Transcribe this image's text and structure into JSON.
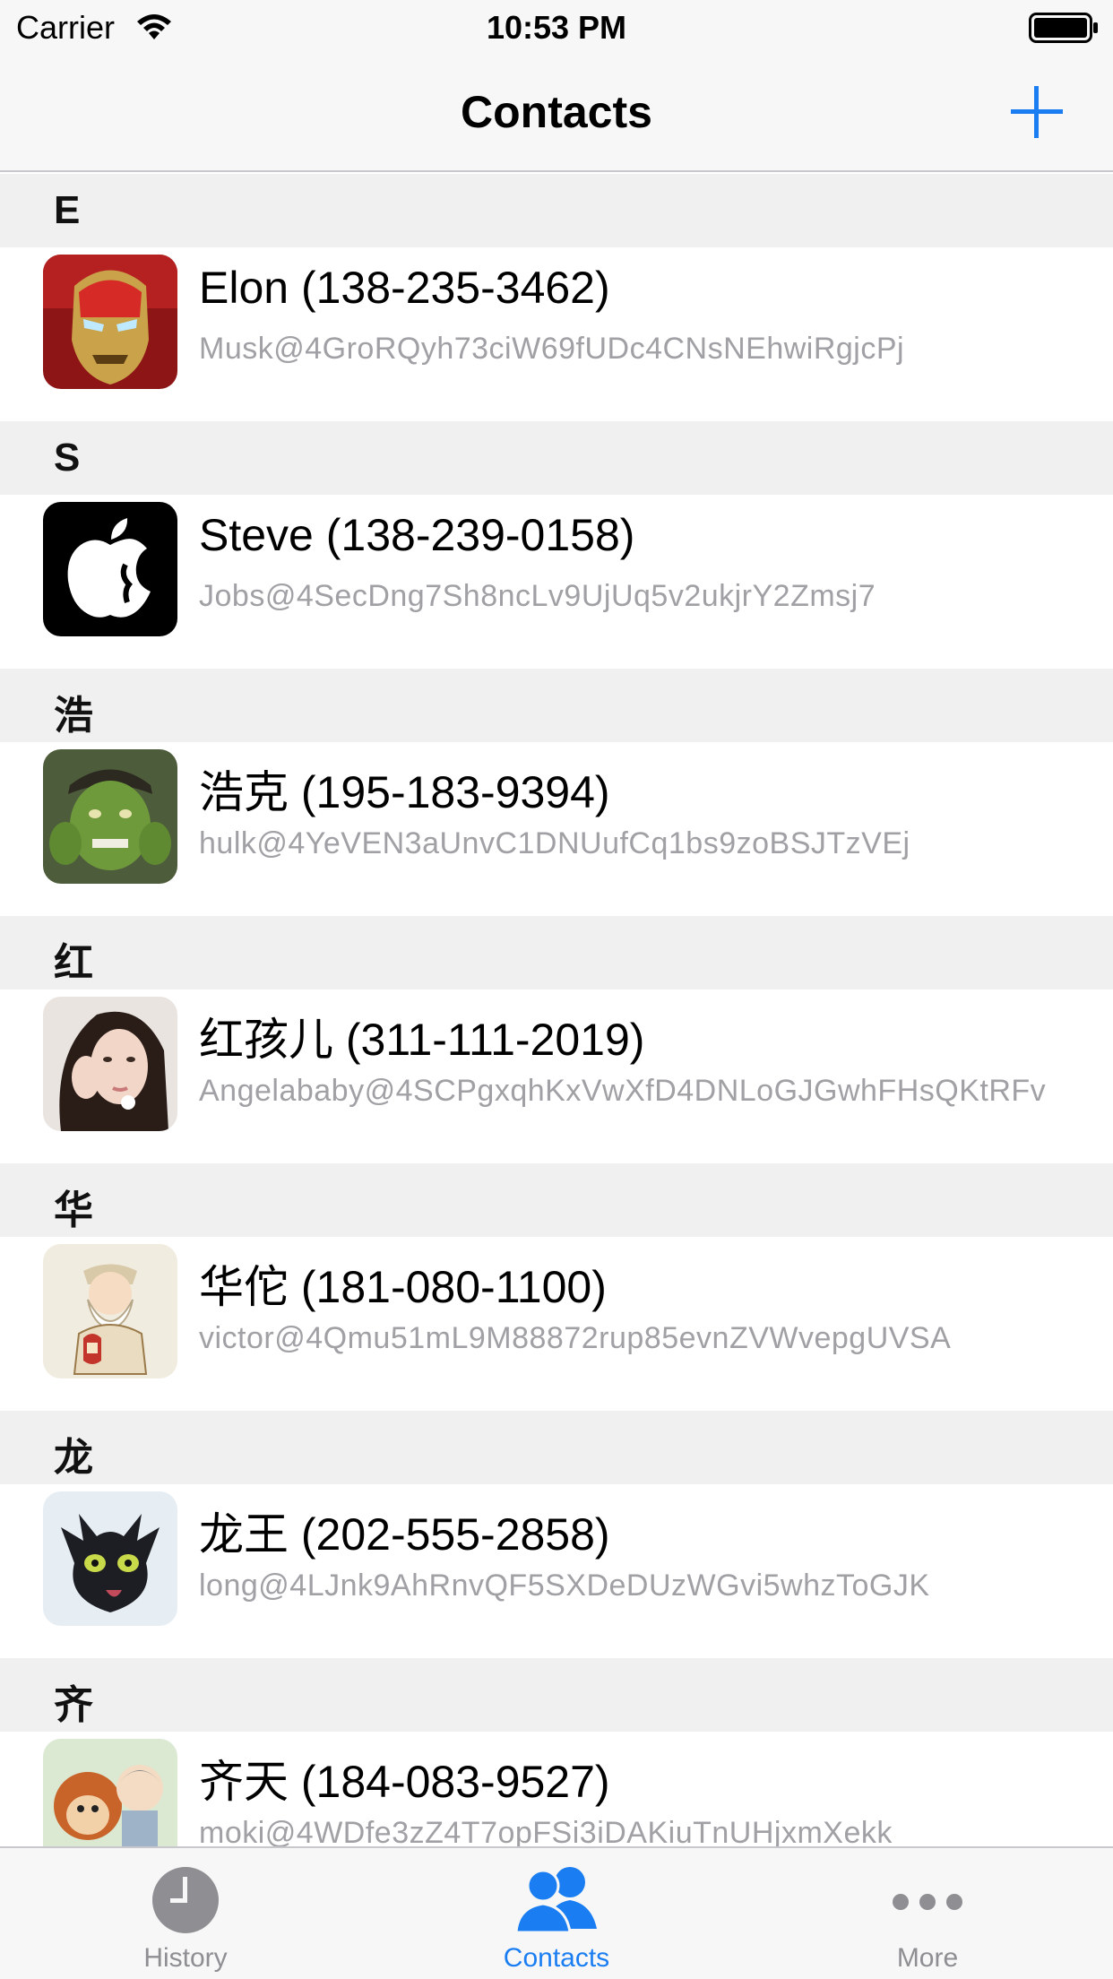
{
  "status_bar": {
    "carrier": "Carrier",
    "time": "10:53 PM"
  },
  "nav": {
    "title": "Contacts",
    "add_icon": "plus-icon",
    "accent_color": "#1a7ef2"
  },
  "sections": [
    {
      "header": "E",
      "contacts": [
        {
          "title": "Elon (138-235-3462)",
          "subtitle": "Musk@4GroRQyh73ciW69fUDc4CNsNEhwiRgjcPj",
          "avatar": "iron-man-avatar"
        }
      ]
    },
    {
      "header": "S",
      "contacts": [
        {
          "title": "Steve (138-239-0158)",
          "subtitle": "Jobs@4SecDng7Sh8ncLv9UjUq5v2ukjrY2Zmsj7",
          "avatar": "apple-logo-avatar"
        }
      ]
    },
    {
      "header": "浩",
      "contacts": [
        {
          "title": "浩克 (195-183-9394)",
          "subtitle": "hulk@4YeVEN3aUnvC1DNUufCq1bs9zoBSJTzVEj",
          "avatar": "hulk-avatar"
        }
      ]
    },
    {
      "header": "红",
      "contacts": [
        {
          "title": "红孩儿 (311-111-2019)",
          "subtitle": "Angelababy@4SCPgxqhKxVwXfD4DNLoGJGwhFHsQKtRFv",
          "avatar": "woman-photo-avatar"
        }
      ]
    },
    {
      "header": "华",
      "contacts": [
        {
          "title": "华佗 (181-080-1100)",
          "subtitle": "victor@4Qmu51mL9M88872rup85evnZVWvepgUVSA",
          "avatar": "sage-cartoon-avatar"
        }
      ]
    },
    {
      "header": "龙",
      "contacts": [
        {
          "title": "龙王 (202-555-2858)",
          "subtitle": "long@4LJnk9AhRnvQF5SXDeDUzWGvi5whzToGJK",
          "avatar": "black-dragon-avatar"
        }
      ]
    },
    {
      "header": "齐",
      "contacts": [
        {
          "title": "齐天 (184-083-9527)",
          "subtitle": "moki@4WDfe3zZ4T7opFSi3iDAKiuTnUHjxmXekk",
          "avatar": "monkey-cartoon-avatar"
        }
      ]
    }
  ],
  "tabs": [
    {
      "label": "History",
      "icon": "clock-icon",
      "active": false
    },
    {
      "label": "Contacts",
      "icon": "contacts-icon",
      "active": true
    },
    {
      "label": "More",
      "icon": "more-icon",
      "active": false
    }
  ]
}
